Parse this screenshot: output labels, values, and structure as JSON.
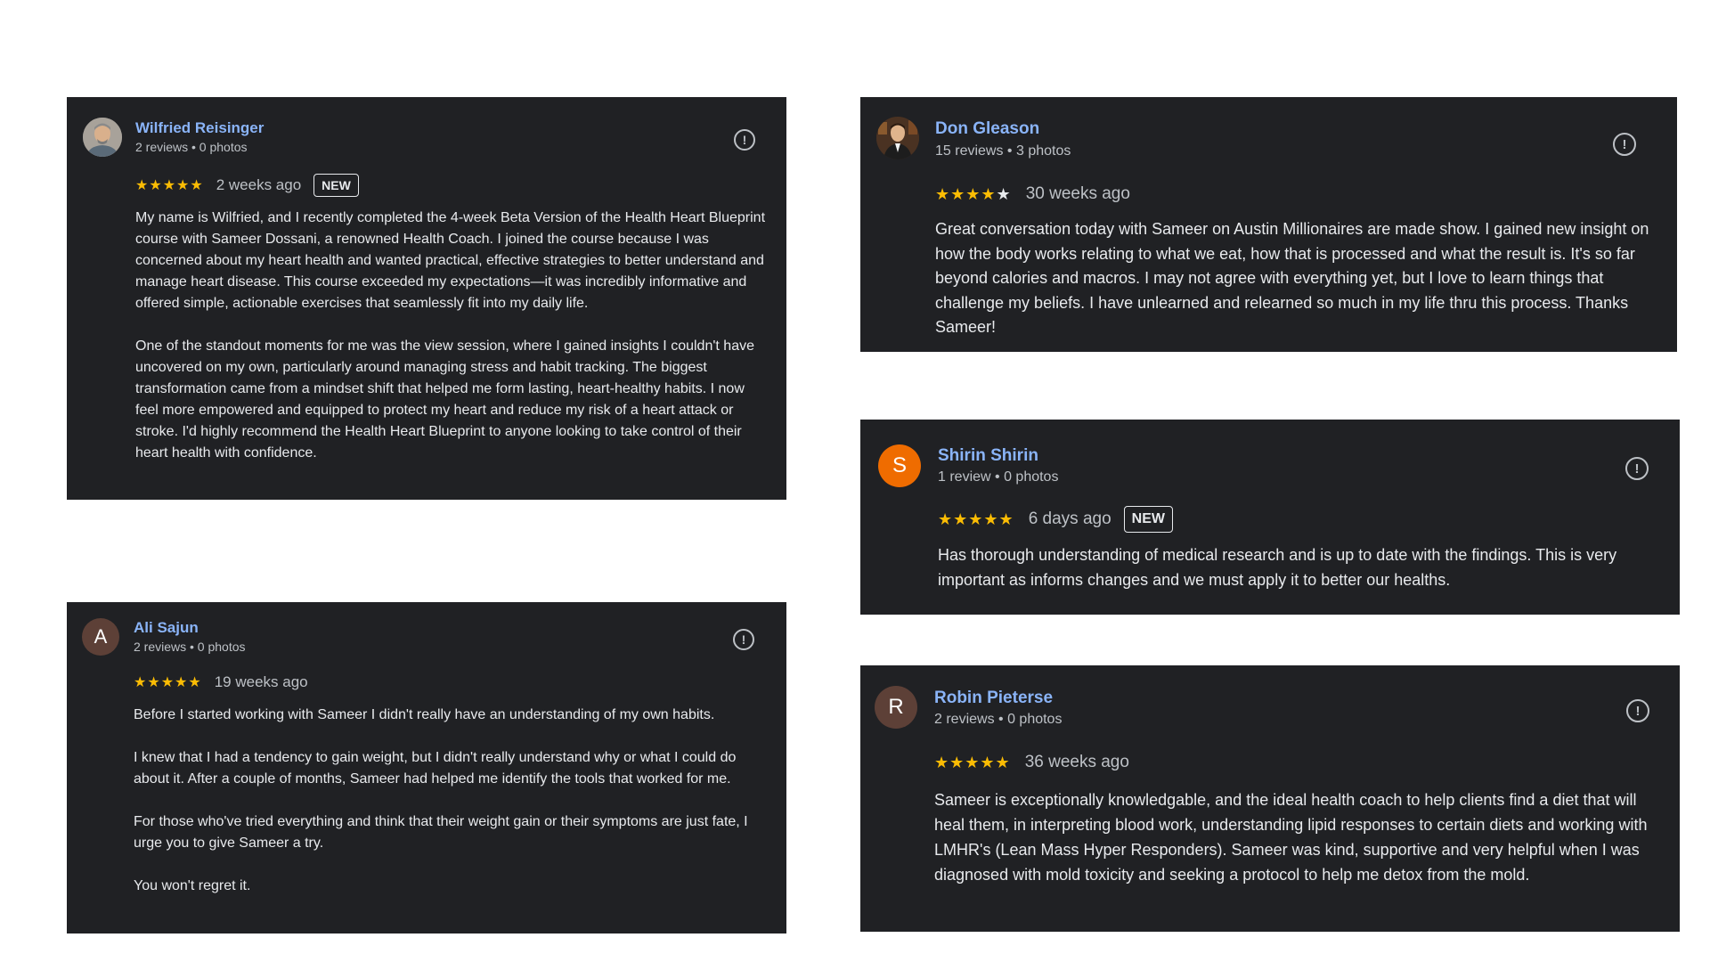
{
  "reviews": [
    {
      "name": "Wilfried Reisinger",
      "meta": "2 reviews • 0 photos",
      "stars": "★★★★★",
      "time": "2 weeks ago",
      "badge": "NEW",
      "avatar_icon": "person-photo-icon",
      "report_icon": "!",
      "paragraphs": [
        "My name is Wilfried, and I recently completed the 4-week Beta Version of the Health Heart Blueprint course with Sameer Dossani, a renowned Health Coach. I joined the course because I was concerned about my heart health and wanted practical, effective strategies to better understand and manage heart disease. This course exceeded my expectations—it was incredibly informative and offered simple, actionable exercises that seamlessly fit into my daily life.",
        "One of the standout moments for me was the view session, where I gained insights I couldn't have uncovered on my own, particularly around managing stress and habit tracking. The biggest transformation came from a mindset shift that helped me form lasting, heart-healthy habits. I now feel more empowered and equipped to protect my heart and reduce my risk of a heart attack or stroke. I'd highly recommend the Health Heart Blueprint to anyone looking to take control of their heart health with confidence."
      ]
    },
    {
      "name": "Ali Sajun",
      "meta": "2 reviews • 0 photos",
      "stars": "★★★★★",
      "time": "19 weeks ago",
      "avatar_letter": "A",
      "avatar_color": "#5d4037",
      "report_icon": "!",
      "paragraphs": [
        "Before I started working with Sameer I didn't really have an understanding of my own habits.",
        "I knew that I had a tendency to gain weight, but I didn't really understand why or what I could do about it. After a couple of months, Sameer had helped me identify the tools that worked for me.",
        "For those who've tried everything and think that their weight gain or their symptoms are just fate, I urge you to give Sameer a try.",
        "You won't regret it."
      ]
    },
    {
      "name": "Don Gleason",
      "meta": "15 reviews • 3 photos",
      "stars_full": "★★★★",
      "stars_empty": "★",
      "time": "30 weeks ago",
      "avatar_icon": "person-photo-icon",
      "report_icon": "!",
      "paragraphs": [
        "Great conversation today with Sameer on Austin Millionaires are made show. I gained new insight on how the body works relating to what we eat, how that is processed and what the result is. It's so far beyond calories and macros. I may not agree with everything yet, but I love to learn things that challenge my beliefs. I have unlearned and relearned so much in my life thru this process. Thanks Sameer!"
      ]
    },
    {
      "name": "Shirin Shirin",
      "meta": "1 review • 0 photos",
      "stars": "★★★★★",
      "time": "6 days ago",
      "badge": "NEW",
      "avatar_letter": "S",
      "avatar_color": "#ef6c00",
      "report_icon": "!",
      "paragraphs": [
        "Has thorough understanding of medical research and is up to date with the findings. This is very important as informs changes and we must apply it to better our healths."
      ]
    },
    {
      "name": "Robin Pieterse",
      "meta": "2 reviews • 0 photos",
      "stars": "★★★★★",
      "time": "36 weeks ago",
      "avatar_letter": "R",
      "avatar_color": "#5d4037",
      "report_icon": "!",
      "paragraphs": [
        "Sameer is exceptionally knowledgable, and the ideal health coach to help clients find a diet that will heal them, in interpreting blood work, understanding lipid responses to certain diets and working with LMHR's (Lean Mass Hyper Responders). Sameer was kind, supportive and very helpful when I was diagnosed with mold toxicity and seeking a protocol to help me detox from the mold."
      ]
    }
  ],
  "colors": {
    "card_bg": "#202124",
    "name": "#8ab4f8",
    "star": "#fbbc04",
    "text": "#e8eaed",
    "meta": "#bdc1c6"
  }
}
